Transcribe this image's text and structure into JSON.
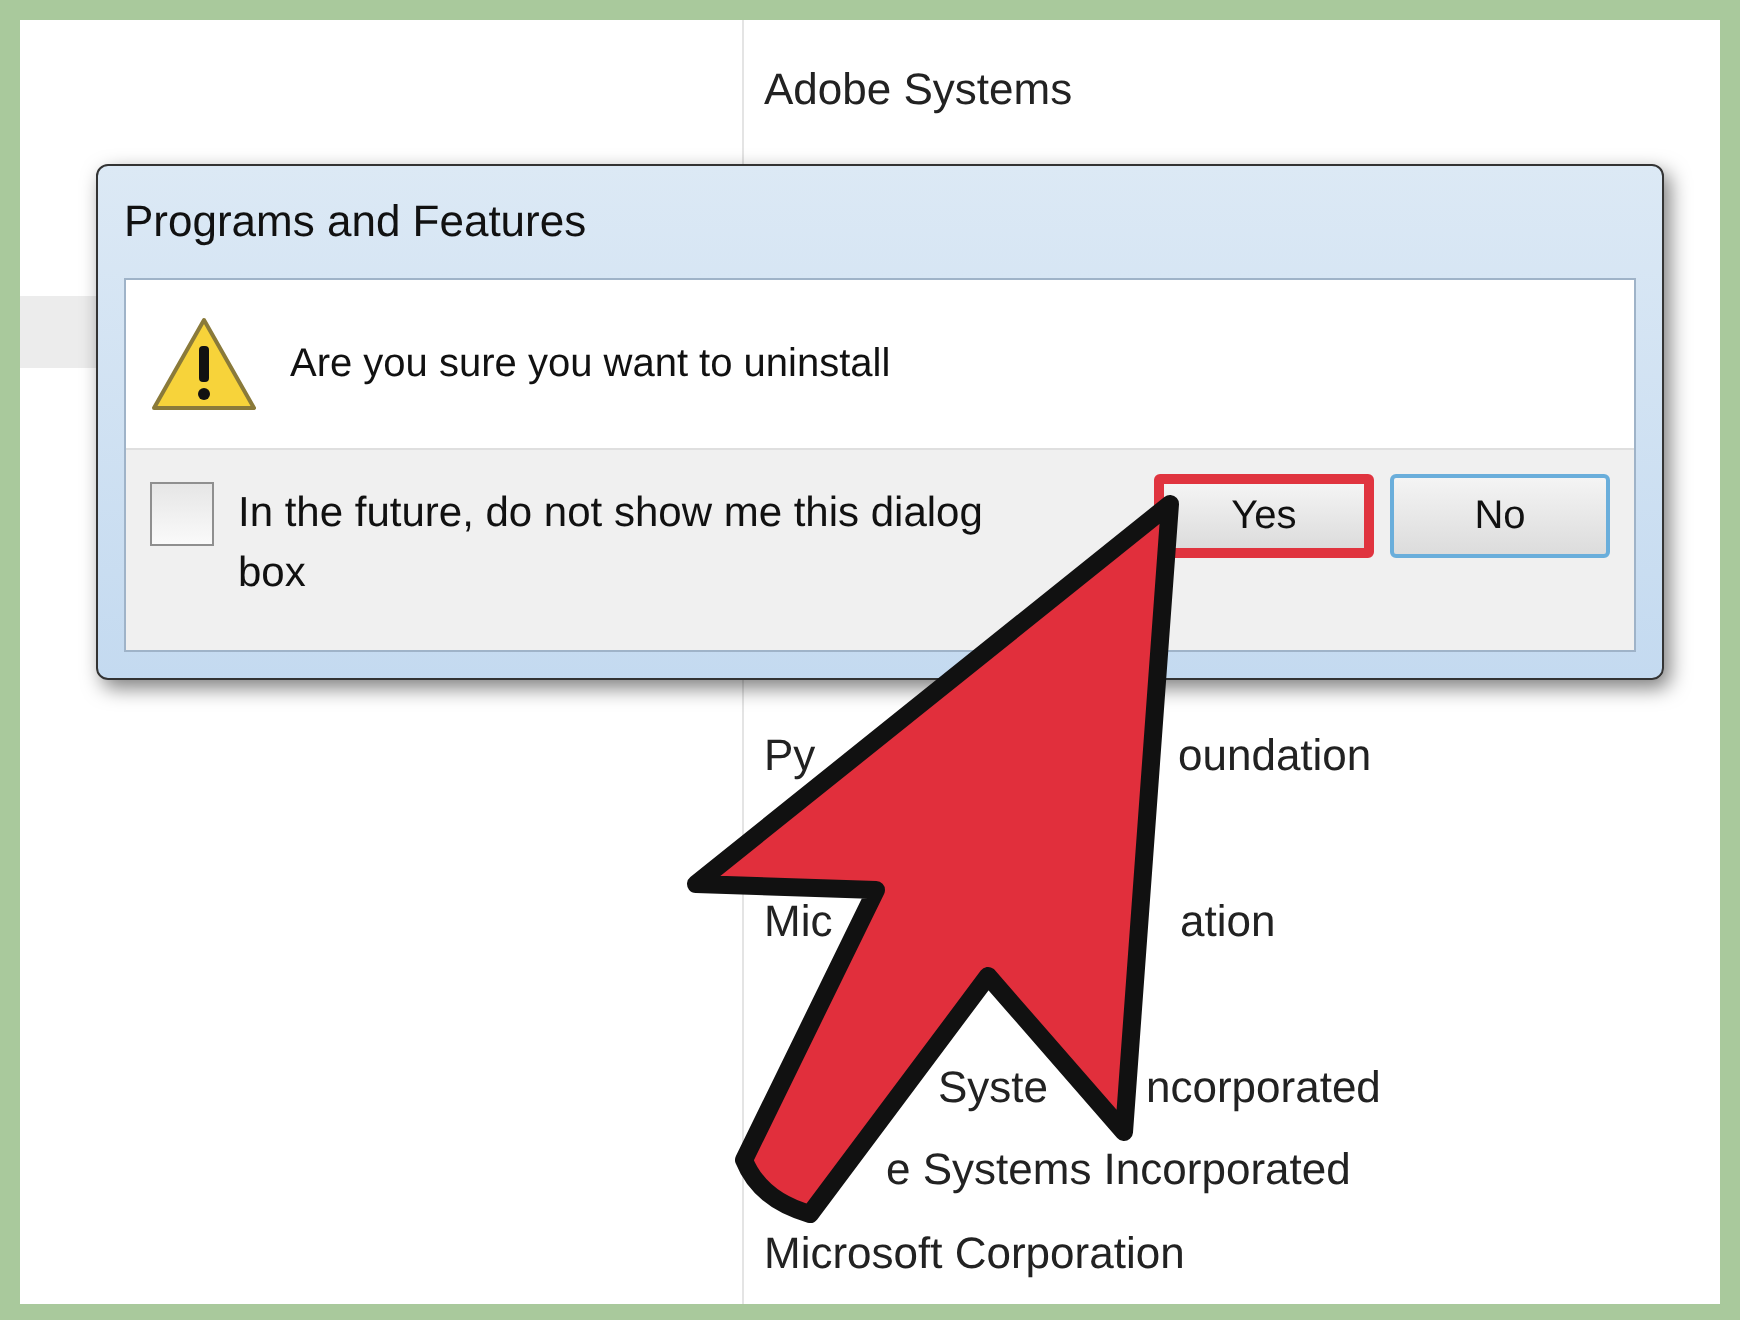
{
  "program_list": {
    "rows_top": [
      "Adobe Systems"
    ],
    "rows_bottom": [
      {
        "parts": [
          "Py",
          "oundation"
        ]
      },
      {
        "parts": [
          "Mic",
          "ation"
        ]
      },
      {
        "parts": [
          "Syste",
          "ncorporated"
        ]
      },
      {
        "parts": [
          "e Systems Incorporated"
        ]
      },
      {
        "parts": [
          "Microsoft Corporation"
        ]
      }
    ]
  },
  "dialog": {
    "title": "Programs and Features",
    "message": "Are you sure you want to uninstall",
    "checkbox": {
      "label": "In the future, do not show me this dialog box",
      "checked": false
    },
    "buttons": [
      {
        "label": "Yes",
        "highlighted": true
      },
      {
        "label": "No",
        "highlighted": false
      }
    ]
  }
}
